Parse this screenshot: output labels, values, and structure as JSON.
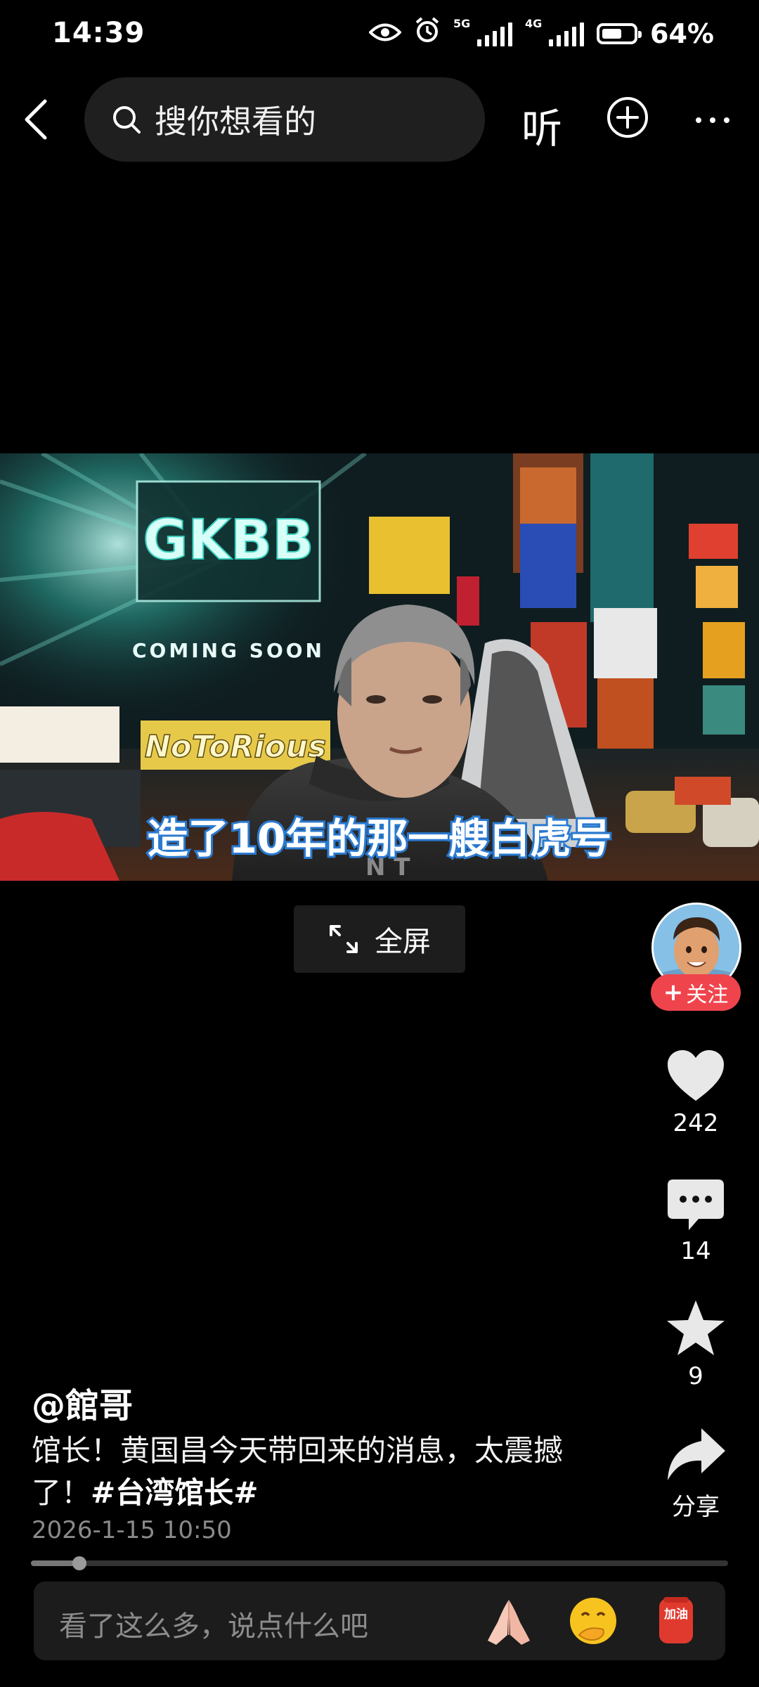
{
  "status_bar": {
    "time": "14:39",
    "network_1": "5G",
    "network_2": "4G",
    "battery_text": "64%",
    "battery_level": 0.64
  },
  "header": {
    "search_placeholder": "搜你想看的",
    "listen_label": "听"
  },
  "video": {
    "subtitle": "造了10年的那一艘白虎号",
    "billboard_title": "GKBB",
    "billboard_sub": "COMING SOON",
    "sign_text": "NoToRious"
  },
  "fullscreen": {
    "label": "全屏"
  },
  "author_rail": {
    "follow_label": "关注",
    "likes": "242",
    "comments": "14",
    "favorites": "9",
    "share_label": "分享"
  },
  "post": {
    "author": "@館哥",
    "description": "馆长！黄国昌今天带回来的消息，太震撼了！",
    "hashtag": "#台湾馆长#",
    "timestamp": "2026-1-15 10:50",
    "progress": 0.07
  },
  "comment_bar": {
    "placeholder": "看了这么多，说点什么吧",
    "sticker_label": "加油"
  },
  "colors": {
    "background": "#000000",
    "follow_red": "#f0444c",
    "surface": "#1c1c1c"
  }
}
